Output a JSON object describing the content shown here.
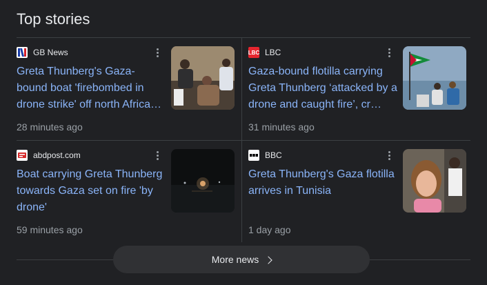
{
  "section_title": "Top stories",
  "stories": [
    {
      "source": "GB News",
      "logo_text": "",
      "headline": "Greta Thunberg's Gaza-bound boat 'firebombed in drone strike' off north Africa…",
      "time": "28 minutes ago"
    },
    {
      "source": "LBC",
      "logo_text": "LBC",
      "headline": "Gaza-bound flotilla carrying Greta Thunberg ‘attacked by a drone and caught fire’, cr…",
      "time": "31 minutes ago"
    },
    {
      "source": "abdpost.com",
      "logo_text": "",
      "headline": "Boat carrying Greta Thunberg towards Gaza set on fire 'by drone'",
      "time": "59 minutes ago"
    },
    {
      "source": "BBC",
      "logo_text": "BBC",
      "headline": "Greta Thunberg's Gaza flotilla arrives in Tunisia",
      "time": "1 day ago"
    }
  ],
  "more_button": "More news",
  "colors": {
    "background": "#202124",
    "headline": "#8ab4f8",
    "meta": "#9aa0a6",
    "divider": "#3c4043"
  }
}
